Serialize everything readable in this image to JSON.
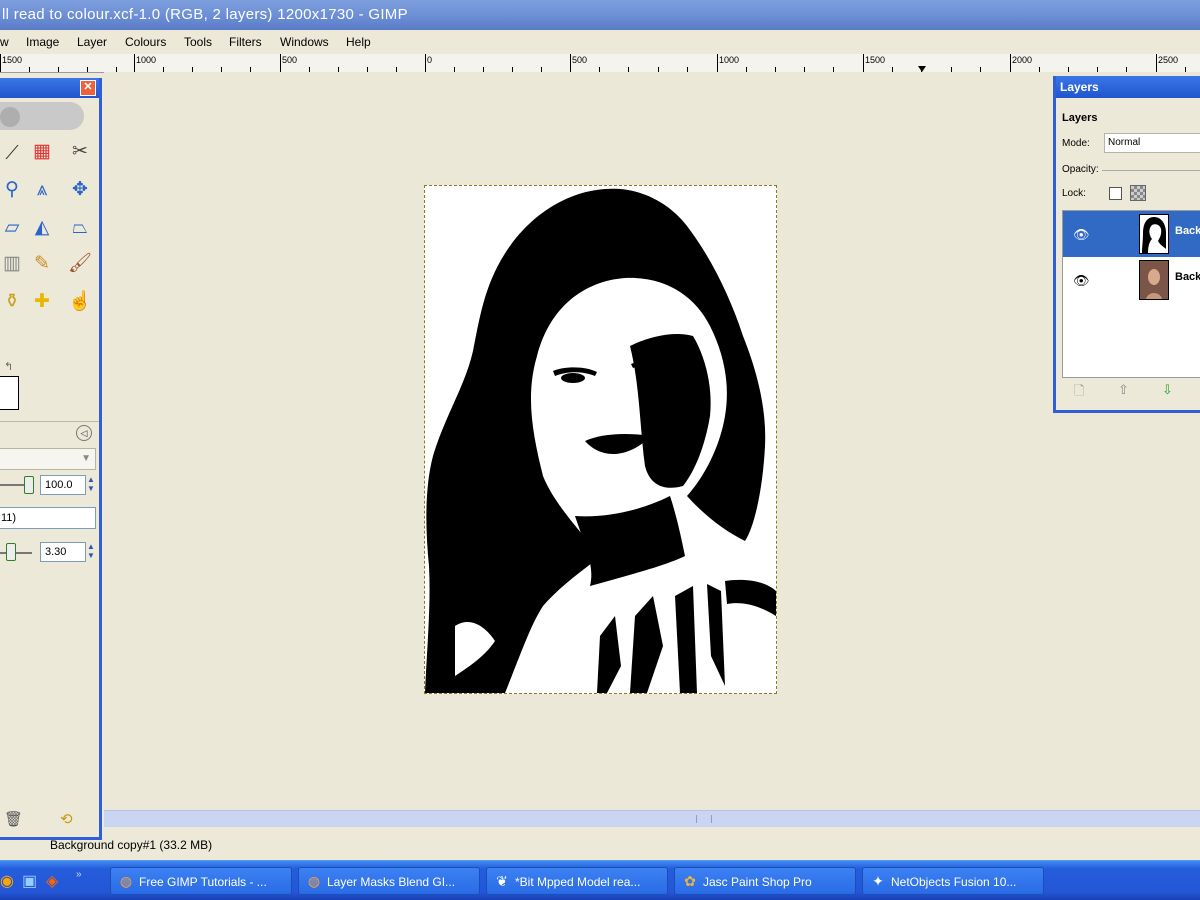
{
  "window": {
    "title": "ll read to colour.xcf-1.0 (RGB, 2 layers) 1200x1730 - GIMP"
  },
  "menu": {
    "items": [
      "w",
      "Image",
      "Layer",
      "Colours",
      "Tools",
      "Filters",
      "Windows",
      "Help"
    ]
  },
  "ruler": {
    "labels": [
      "1500",
      "1000",
      "500",
      "0",
      "500",
      "1000",
      "1500",
      "2000",
      "2500"
    ]
  },
  "toolbox": {
    "tools": [
      "knife-icon",
      "paint-select-icon",
      "scissors-icon",
      "zoom-icon",
      "measure-icon",
      "move-icon",
      "shear-icon",
      "flip-icon",
      "perspective-icon",
      "gradient-icon",
      "pencil-icon",
      "brush-icon",
      "clone-icon",
      "heal-icon",
      "smudge-icon"
    ],
    "opacity_value": "100.0",
    "brush_field": "11)",
    "scale_value": "3.30"
  },
  "layers": {
    "title": "Layers",
    "header": "Layers",
    "mode_label": "Mode:",
    "mode_value": "Normal",
    "opacity_label": "Opacity:",
    "lock_label": "Lock:",
    "items": [
      {
        "name": "Back",
        "selected": true,
        "thumb": "bw"
      },
      {
        "name": "Back",
        "selected": false,
        "thumb": "color"
      }
    ]
  },
  "status": {
    "text": "Background copy#1 (33.2 MB)"
  },
  "taskbar": {
    "tasks": [
      {
        "label": "Free GIMP Tutorials - ...",
        "icon": "firefox-icon"
      },
      {
        "label": "Layer Masks Blend GI...",
        "icon": "firefox-icon"
      },
      {
        "label": "*Bit Mpped Model rea...",
        "icon": "gimp-icon"
      },
      {
        "label": "Jasc Paint Shop Pro",
        "icon": "psp-icon"
      },
      {
        "label": "NetObjects Fusion 10...",
        "icon": "netobjects-icon"
      }
    ]
  },
  "colors": {
    "accent": "#2F5ED6",
    "selection": "#316AC5",
    "taskbar": "#245DDB"
  }
}
